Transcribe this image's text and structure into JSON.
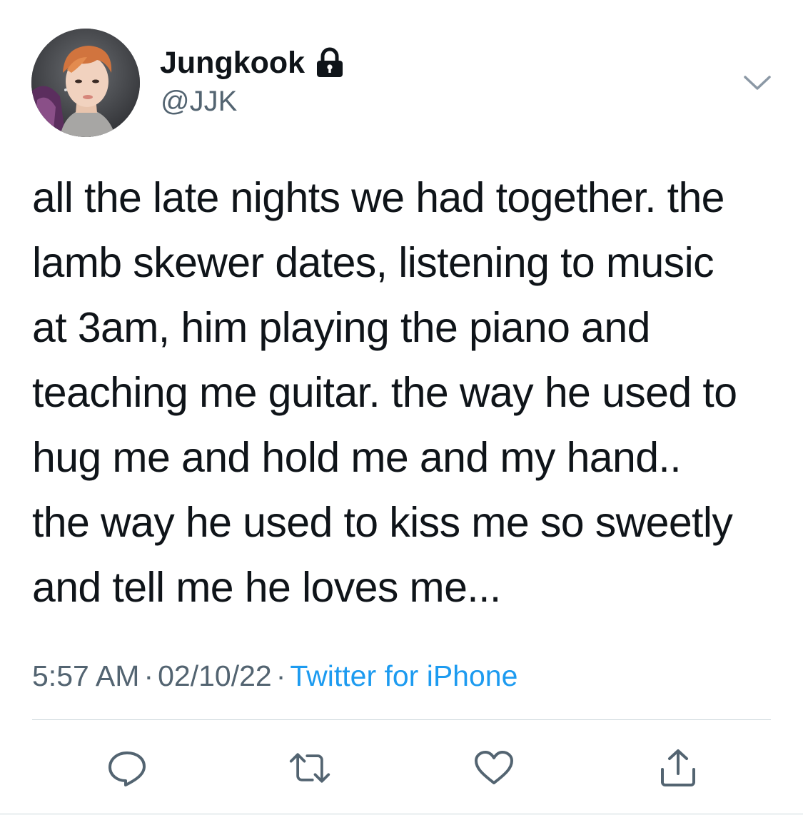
{
  "author": {
    "display_name": "Jungkook",
    "handle": "@JJK",
    "protected": true,
    "avatar_icon": "profile-photo",
    "lock_icon": "lock-icon"
  },
  "tweet": {
    "text": "all the late nights we had together. the\nlamb skewer dates, listening to music\nat 3am, him playing the piano and\nteaching me guitar. the way he used to\nhug me and hold me and my hand..\nthe way he used to kiss me so sweetly\nand tell me he loves me...",
    "time": "5:57 AM",
    "separator": "·",
    "date": "02/10/22",
    "source": "Twitter for iPhone"
  },
  "actions": [
    {
      "name": "reply",
      "icon": "reply-icon"
    },
    {
      "name": "retweet",
      "icon": "retweet-icon"
    },
    {
      "name": "like",
      "icon": "heart-icon"
    },
    {
      "name": "share",
      "icon": "share-icon"
    }
  ],
  "colors": {
    "text": "#0f1419",
    "secondary": "#536471",
    "link": "#1d9bf0",
    "divider": "#cfd9de"
  }
}
